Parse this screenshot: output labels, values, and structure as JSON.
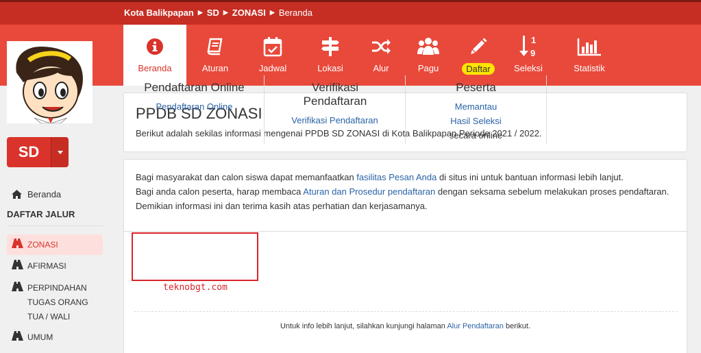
{
  "breadcrumb": {
    "city": "Kota Balikpapan",
    "level": "SD",
    "track": "ZONASI",
    "current": "Beranda"
  },
  "nav": {
    "items": [
      {
        "label": "Beranda",
        "icon": "info-icon"
      },
      {
        "label": "Aturan",
        "icon": "book-icon"
      },
      {
        "label": "Jadwal",
        "icon": "calendar-check-icon"
      },
      {
        "label": "Lokasi",
        "icon": "signpost-icon"
      },
      {
        "label": "Alur",
        "icon": "shuffle-icon"
      },
      {
        "label": "Pagu",
        "icon": "users-icon"
      },
      {
        "label": "Daftar",
        "icon": "pencil-icon"
      },
      {
        "label": "Seleksi",
        "icon": "sort-numeric-icon"
      },
      {
        "label": "Statistik",
        "icon": "bar-chart-icon"
      }
    ]
  },
  "sidebar": {
    "level_button": "SD",
    "home_label": "Beranda",
    "section_title": "DAFTAR JALUR",
    "items": [
      {
        "label": "ZONASI"
      },
      {
        "label": "AFIRMASI"
      },
      {
        "label": "PERPINDAHAN TUGAS ORANG TUA / WALI"
      },
      {
        "label": "UMUM"
      }
    ]
  },
  "header": {
    "title": "PPDB SD ZONASI",
    "subtitle": "Berikut adalah sekilas informasi mengenai PPDB SD ZONASI di Kota Balikpapan Periode 2021 / 2022."
  },
  "info": {
    "line1_a": "Bagi masyarakat dan calon siswa dapat memanfaatkan ",
    "line1_link": "fasilitas Pesan Anda",
    "line1_b": " di situs ini untuk bantuan informasi lebih lanjut.",
    "line2_a": "Bagi anda calon peserta, harap membaca ",
    "line2_link": "Aturan dan Prosedur pendaftaran",
    "line2_b": " dengan seksama sebelum melakukan proses pendaftaran. Demikian informasi ini dan terima kasih atas perhatian dan kerjasamanya."
  },
  "columns": [
    {
      "title": "Pendaftaran Online",
      "link": "Pendaftaran Online"
    },
    {
      "title": "Verifikasi Pendaftaran",
      "link": "Verifikasi Pendaftaran"
    },
    {
      "title": "Peserta",
      "link": "Memantau Hasil Seleksi",
      "link_line1": "Memantau",
      "link_line2": "Hasil Seleksi",
      "note": "secara online"
    }
  ],
  "watermark": "teknobgt.com",
  "footnote": {
    "text_a": "Untuk info lebih lanjut, silahkan kunjungi halaman ",
    "link": "Alur Pendaftaran",
    "text_b": " berikut."
  },
  "colors": {
    "brand": "#e8493b",
    "brand_dark": "#c62e24",
    "highlight_badge": "#ffe500",
    "link": "#2a63a6"
  }
}
